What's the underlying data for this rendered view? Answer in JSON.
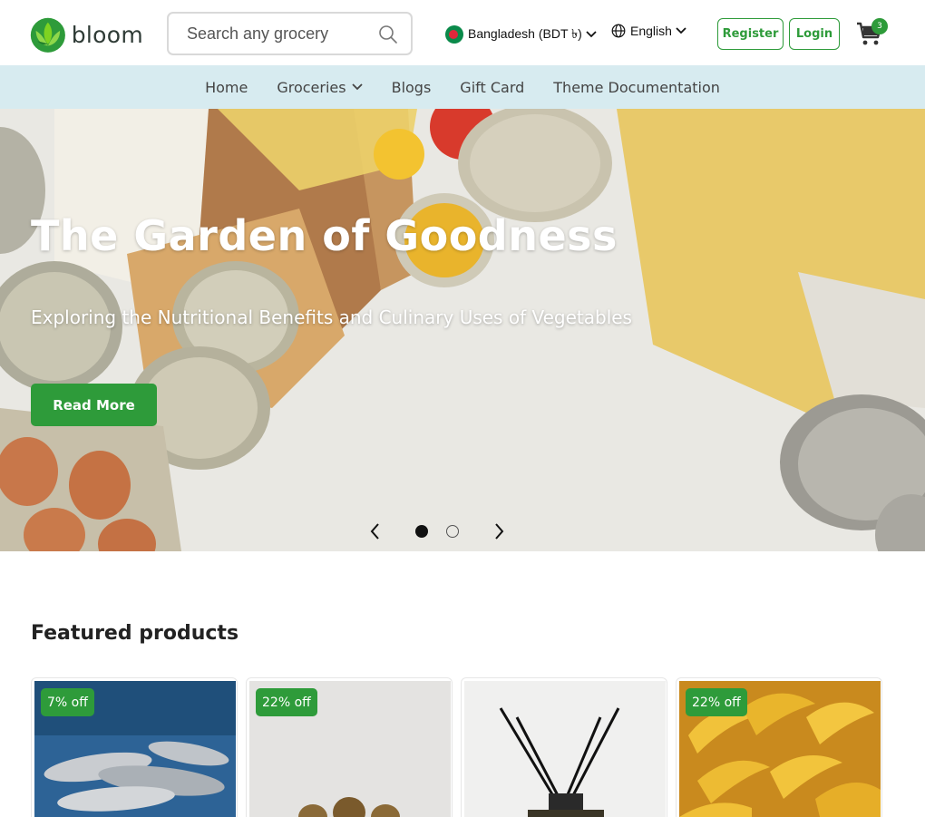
{
  "brand": {
    "name": "bloom",
    "accent": "#2e9b3a"
  },
  "search": {
    "placeholder": "Search any grocery",
    "icon": "search-icon"
  },
  "locale": {
    "country": "Bangladesh (BDT ৳)",
    "language": "English"
  },
  "auth": {
    "register_label": "Register",
    "login_label": "Login"
  },
  "cart": {
    "count": "3"
  },
  "nav": {
    "items": [
      {
        "label": "Home"
      },
      {
        "label": "Groceries"
      },
      {
        "label": "Blogs"
      },
      {
        "label": "Gift Card"
      },
      {
        "label": "Theme Documentation"
      }
    ]
  },
  "hero": {
    "title": "The Garden of Goodness",
    "subtitle": "Exploring the Nutritional Benefits and Culinary Uses of Vegetables",
    "cta_label": "Read More",
    "active_slide": 1,
    "slide_count": 2
  },
  "featured": {
    "title": "Featured products",
    "products": [
      {
        "badge": "7% off"
      },
      {
        "badge": "22% off"
      },
      {
        "badge": ""
      },
      {
        "badge": "22% off"
      }
    ]
  }
}
